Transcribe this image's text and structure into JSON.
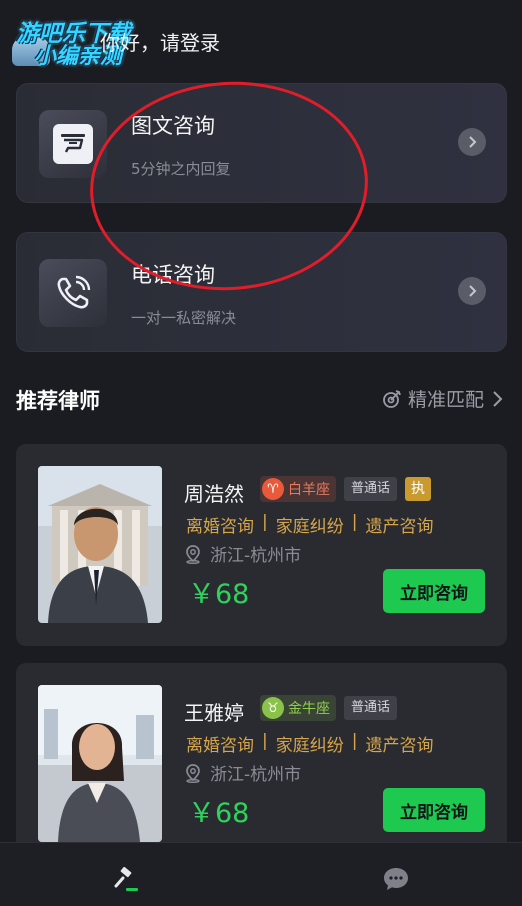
{
  "header": {
    "watermark_line1": "游吧乐下载",
    "watermark_line2": "小编亲测",
    "greeting": "你好，请登录"
  },
  "consult_options": [
    {
      "title": "图文咨询",
      "subtitle": "5分钟之内回复",
      "icon": "chat-document-icon"
    },
    {
      "title": "电话咨询",
      "subtitle": "一对一私密解决",
      "icon": "phone-icon"
    }
  ],
  "section": {
    "title": "推荐律师",
    "match_label": "精准匹配"
  },
  "lawyers": [
    {
      "name": "周浩然",
      "zodiac": "白羊座",
      "zodiac_color": "#e85a3a",
      "language": "普通话",
      "badge": "执",
      "areas": [
        "离婚咨询",
        "家庭纠纷",
        "遗产咨询"
      ],
      "separator": "|",
      "location": "浙江-杭州市",
      "price": "￥68",
      "button": "立即咨询"
    },
    {
      "name": "王雅婷",
      "zodiac": "金牛座",
      "zodiac_color": "#8bc34a",
      "language": "普通话",
      "areas": [
        "离婚咨询",
        "家庭纠纷",
        "遗产咨询"
      ],
      "separator": "|",
      "location": "浙江-杭州市",
      "price": "￥68",
      "button": "立即咨询"
    }
  ],
  "tabbar": {
    "items": [
      {
        "icon": "gavel-icon",
        "active": true
      },
      {
        "icon": "message-icon",
        "active": false
      }
    ]
  },
  "colors": {
    "accent_green": "#1ec94f",
    "price_green": "#2fd35b",
    "area_gold": "#d7a64a",
    "annotation_red": "#e11d2a"
  }
}
